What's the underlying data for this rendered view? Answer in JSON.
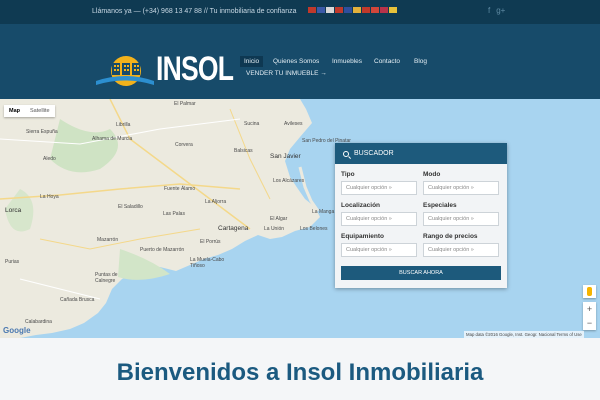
{
  "topbar": {
    "phone_text": "Llámanos ya — (+34) 968 13 47 88 // Tu inmobiliaria de confianza",
    "flags": [
      "#c0392b",
      "#3b5aa8",
      "#d9d9d9",
      "#c0392b",
      "#2f4f9e",
      "#e2b13c",
      "#c0392b",
      "#d0463a",
      "#b8334a",
      "#e8c23a"
    ],
    "social_icons": [
      "facebook-icon",
      "google-plus-icon"
    ]
  },
  "header": {
    "logo_text": "INSOL",
    "nav": [
      {
        "label": "Inicio",
        "active": true
      },
      {
        "label": "Quienes Somos"
      },
      {
        "label": "Inmuebles"
      },
      {
        "label": "Contacto"
      },
      {
        "label": "Blog"
      },
      {
        "label": "VENDER TU INMUEBLE →"
      }
    ]
  },
  "map": {
    "types": [
      "Map",
      "Satellite"
    ],
    "towns": [
      {
        "label": "El Palmar"
      },
      {
        "label": "Sucina"
      },
      {
        "label": "Avileses"
      },
      {
        "label": "Librilla"
      },
      {
        "label": "Sierra Espuña"
      },
      {
        "label": "Alhama de Murcia"
      },
      {
        "label": "Corvera"
      },
      {
        "label": "Balsicas"
      },
      {
        "label": "San Javier"
      },
      {
        "label": "San Pedro del Pinatar"
      },
      {
        "label": "Aledo"
      },
      {
        "label": "Fuente Álamo"
      },
      {
        "label": "Los Alcázares"
      },
      {
        "label": "La Hoya"
      },
      {
        "label": "La Aljorra"
      },
      {
        "label": "Lorca"
      },
      {
        "label": "El Saladillo"
      },
      {
        "label": "Las Palas"
      },
      {
        "label": "El Algar"
      },
      {
        "label": "La Manga"
      },
      {
        "label": "Cartagena"
      },
      {
        "label": "La Unión"
      },
      {
        "label": "Los Belones"
      },
      {
        "label": "Mazarrón"
      },
      {
        "label": "El Porrús"
      },
      {
        "label": "Puerto de Mazarrón"
      },
      {
        "label": "La Muela-Cabo Tiñoso"
      },
      {
        "label": "Puntas de Calnegre"
      },
      {
        "label": "Cañada Brusca"
      },
      {
        "label": "Calabardina"
      },
      {
        "label": "Purias"
      }
    ],
    "attribution": "Map data ©2016 Google, Inst. Geogr. Nacional    Terms of Use",
    "google_label": "Google",
    "zoom_in": "+",
    "zoom_out": "−"
  },
  "search": {
    "title": "BUSCADOR",
    "fields": [
      {
        "label": "Tipo",
        "value": "Cualquier opción »"
      },
      {
        "label": "Modo",
        "value": "Cualquier opción »"
      },
      {
        "label": "Localización",
        "value": "Cualquier opción »"
      },
      {
        "label": "Especiales",
        "value": "Cualquier opción »"
      },
      {
        "label": "Equipamiento",
        "value": "Cualquier opción »"
      },
      {
        "label": "Rango de precios",
        "value": "Cualquier opción »"
      }
    ],
    "button_label": "BUSCAR AHORA"
  },
  "welcome": {
    "title": "Bienvenidos a Insol Inmobiliaria"
  }
}
